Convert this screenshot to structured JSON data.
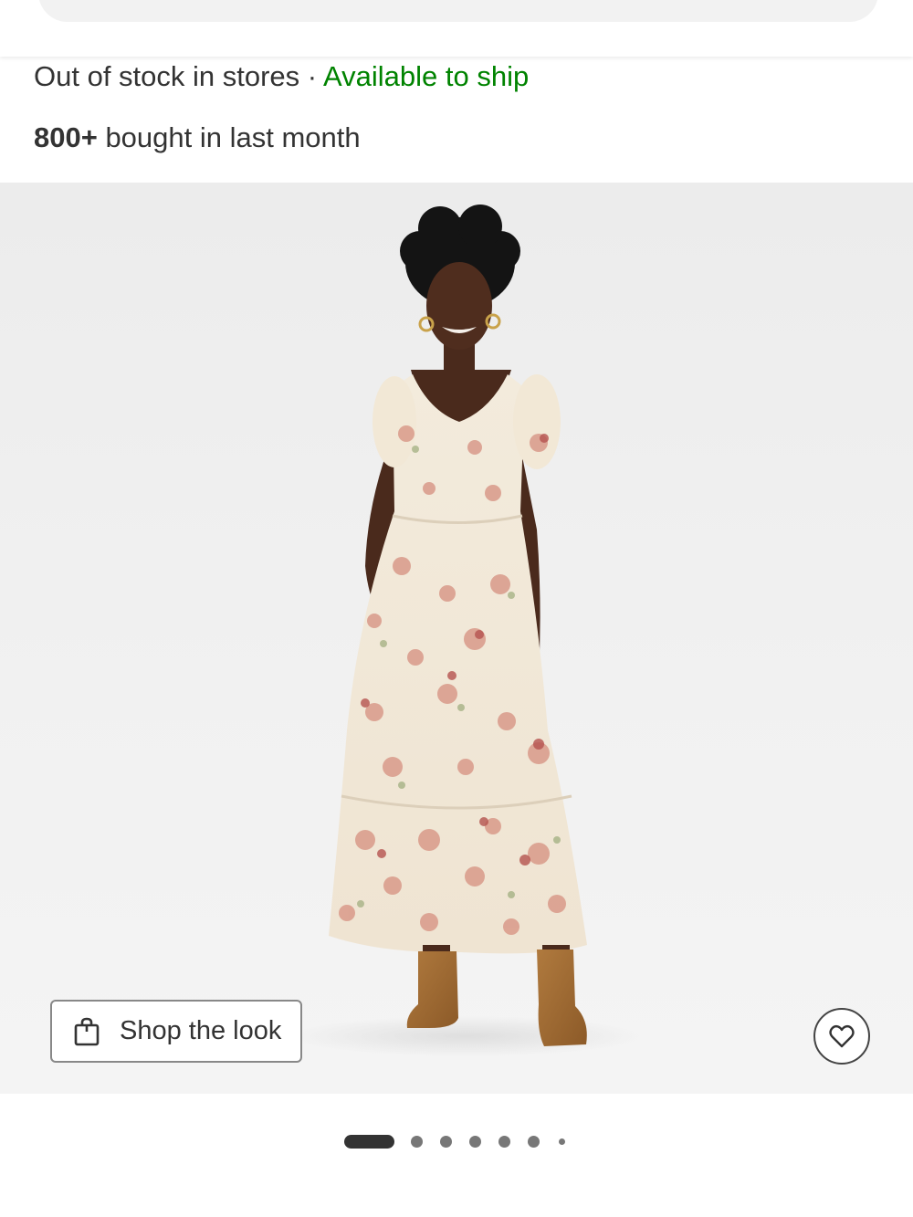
{
  "availability": {
    "store_status": "Out of stock in stores",
    "separator": " · ",
    "ship_status": "Available to ship",
    "ship_color": "#008300"
  },
  "popularity": {
    "count": "800+",
    "text": " bought in last month"
  },
  "gallery": {
    "image": "woman-in-floral-maxi-dress",
    "shop_the_look_label": "Shop the look",
    "shop_icon": "shopping-bag-icon",
    "favorite_icon": "heart-icon",
    "carousel": {
      "total_dots": 7,
      "active_index": 0
    }
  }
}
